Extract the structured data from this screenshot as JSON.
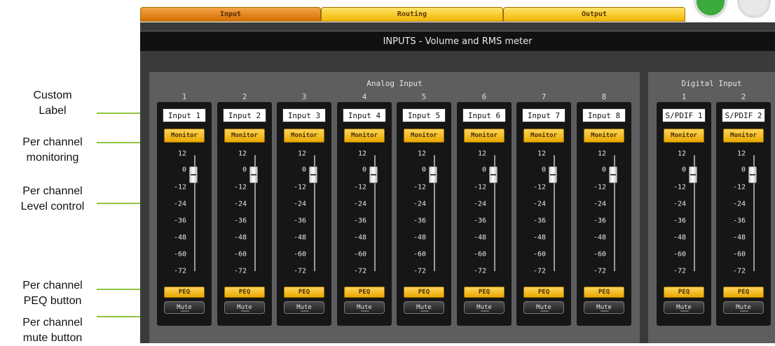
{
  "callouts": {
    "label": [
      "Custom",
      "Label"
    ],
    "monitor": [
      "Per channel",
      "monitoring"
    ],
    "level": [
      "Per channel",
      "Level control"
    ],
    "peq": [
      "Per channel",
      "PEQ button"
    ],
    "mute": [
      "Per channel",
      "mute button"
    ]
  },
  "tabs": [
    {
      "label": "Input",
      "active": true
    },
    {
      "label": "Routing",
      "active": false
    },
    {
      "label": "Output",
      "active": false
    }
  ],
  "title": "INPUTS - Volume and RMS meter",
  "groups": {
    "analog": "Analog Input",
    "digital": "Digital Input"
  },
  "channels": [
    {
      "num": "1",
      "label": "Input 1",
      "level": 0
    },
    {
      "num": "2",
      "label": "Input 2",
      "level": 0
    },
    {
      "num": "3",
      "label": "Input 3",
      "level": 0
    },
    {
      "num": "4",
      "label": "Input 4",
      "level": 0
    },
    {
      "num": "5",
      "label": "Input 5",
      "level": 0
    },
    {
      "num": "6",
      "label": "Input 6",
      "level": 0
    },
    {
      "num": "7",
      "label": "Input 7",
      "level": 0
    },
    {
      "num": "8",
      "label": "Input 8",
      "level": 0
    },
    {
      "num": "1",
      "label": "S/PDIF 1",
      "level": 0
    },
    {
      "num": "2",
      "label": "S/PDIF 2",
      "level": 0
    }
  ],
  "scale": [
    "12",
    "0",
    "-12",
    "-24",
    "-36",
    "-48",
    "-60",
    "-72"
  ],
  "buttons": {
    "monitor": "Monitor",
    "peq": "PEQ",
    "mute": "Mute"
  },
  "colors": {
    "accent": "#f0b800",
    "active_tab": "#d46e00",
    "arrow": "#8dc63f"
  }
}
